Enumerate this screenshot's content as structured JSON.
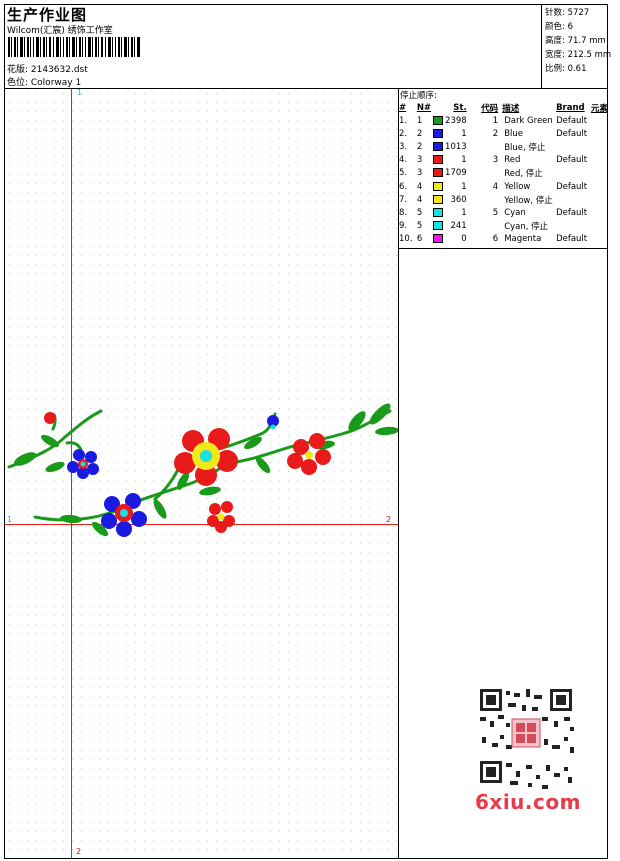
{
  "header": {
    "title": "生产作业图",
    "subtitle": "Wilcom(汇宸) 绣饰工作室",
    "design_file": "花版: 2143632.dst",
    "colorway": "色位:  Colorway 1"
  },
  "stats": {
    "stitches": "针数: 5727",
    "colors": "颜色: 6",
    "height": "高度: 71.7 mm",
    "width": "宽度: 212.5 mm",
    "scale": "比例: 0.61"
  },
  "stop_sequence": {
    "title": "停止顺序:",
    "headers": {
      "num": "#",
      "n": "N#",
      "st": "St.",
      "code": "代码",
      "desc": "描述",
      "brand": "Brand",
      "elem": "元素"
    },
    "rows": [
      {
        "num": "1.",
        "n": "1",
        "color": "#1a9a1a",
        "st": "2398",
        "code": "1",
        "desc": "Dark Green",
        "brand": "Default"
      },
      {
        "num": "2.",
        "n": "2",
        "color": "#1a1ae0",
        "st": "1",
        "code": "2",
        "desc": "Blue",
        "brand": "Default"
      },
      {
        "num": "3.",
        "n": "2",
        "color": "#1a1ae0",
        "st": "1013",
        "code": "",
        "desc": "Blue, 停止",
        "brand": ""
      },
      {
        "num": "4.",
        "n": "3",
        "color": "#e81a1a",
        "st": "1",
        "code": "3",
        "desc": "Red",
        "brand": "Default"
      },
      {
        "num": "5.",
        "n": "3",
        "color": "#e81a1a",
        "st": "1709",
        "code": "",
        "desc": "Red, 停止",
        "brand": ""
      },
      {
        "num": "6.",
        "n": "4",
        "color": "#f0e81a",
        "st": "1",
        "code": "4",
        "desc": "Yellow",
        "brand": "Default"
      },
      {
        "num": "7.",
        "n": "4",
        "color": "#f0e81a",
        "st": "360",
        "code": "",
        "desc": "Yellow, 停止",
        "brand": ""
      },
      {
        "num": "8.",
        "n": "5",
        "color": "#1ae0e0",
        "st": "1",
        "code": "5",
        "desc": "Cyan",
        "brand": "Default"
      },
      {
        "num": "9.",
        "n": "5",
        "color": "#1ae0e0",
        "st": "241",
        "code": "",
        "desc": "Cyan, 停止",
        "brand": ""
      },
      {
        "num": "10.",
        "n": "6",
        "color": "#e81ae8",
        "st": "0",
        "code": "6",
        "desc": "Magenta",
        "brand": "Default"
      }
    ]
  },
  "axes": {
    "v_top": "1",
    "v_bottom": "2",
    "h_left": "1",
    "h_right": "2"
  },
  "watermark": "6xiu.com",
  "colors": {
    "guide_line": "#e8201c",
    "green": "#1a9a1a",
    "blue": "#1a1ae0",
    "red": "#e81a1a",
    "yellow": "#f0e81a",
    "cyan": "#1ae0e0"
  }
}
